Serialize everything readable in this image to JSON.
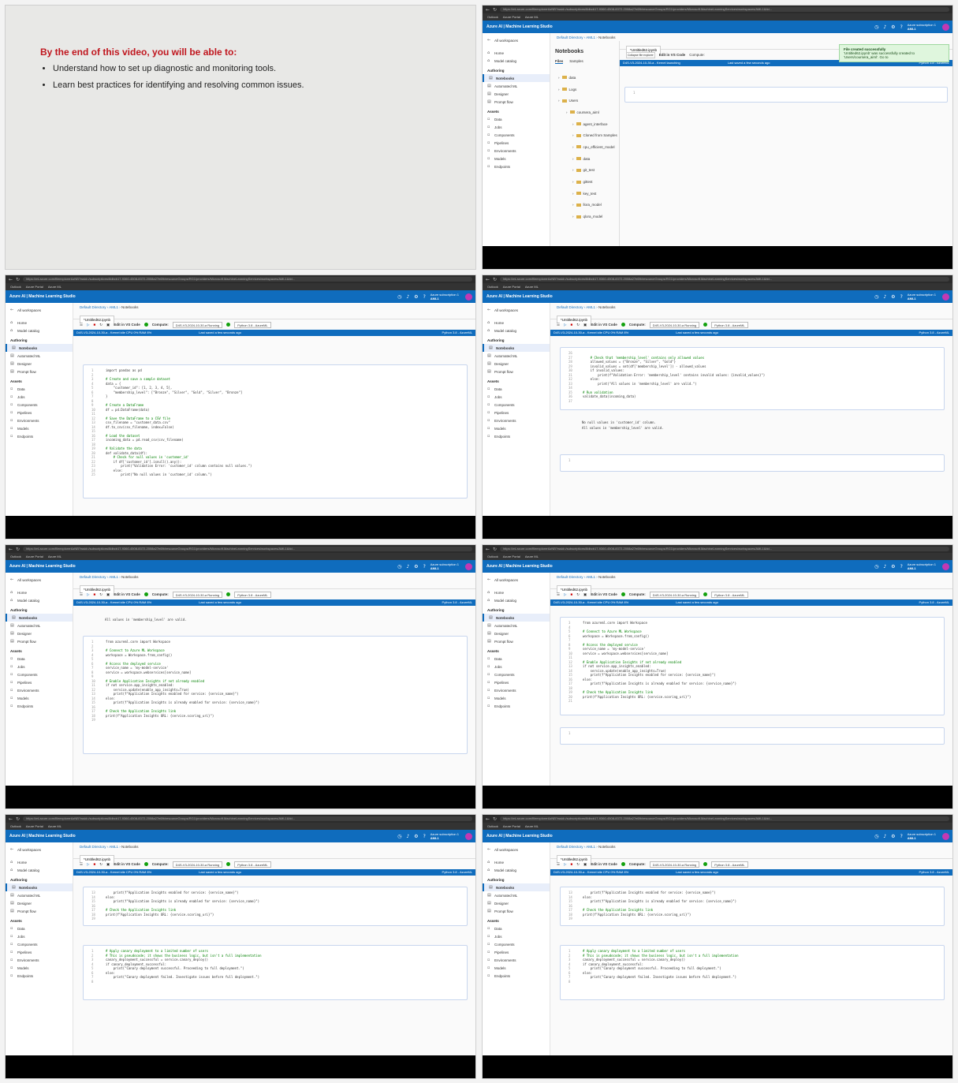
{
  "slide": {
    "heading": "By the end of this video, you will be able to:",
    "bullets": [
      "Understand how to set up diagnostic and monitoring tools.",
      "Learn best practices for identifying and resolving common issues."
    ]
  },
  "browser": {
    "url": "https://ml.azure.com/fileexplorerAzNB?wsid=/subscriptions/8dbcb17-9360-4508-8372-2008a27e6fb/resourceGroups/RG1/providers/Microsoft.MachineLearningServices/workspaces/AML1&tid...",
    "bookmarks": [
      "Outlook",
      "Azure Portal",
      "Azure ML"
    ]
  },
  "app": {
    "brand": "Azure AI | Machine Learning Studio",
    "subscription": "Azure subscription 1",
    "workspace": "AML1",
    "notification_count": "2"
  },
  "sidebar": {
    "all_workspaces": "All workspaces",
    "top_items": [
      "Home",
      "Model catalog"
    ],
    "authoring_label": "Authoring",
    "authoring_items": [
      "Notebooks",
      "Automated ML",
      "Designer",
      "Prompt flow"
    ],
    "assets_label": "Assets",
    "asset_items": [
      "Data",
      "Jobs",
      "Components",
      "Pipelines",
      "Environments",
      "Models",
      "Endpoints"
    ]
  },
  "breadcrumb": [
    "Default Directory",
    "AML1",
    "Notebooks"
  ],
  "notebook": {
    "file_tab": "*Untitled62.ipynb",
    "edit_vscode": "Edit in VS Code",
    "compute_label": "Compute:",
    "compute_name": "D4S-V3-2024-10-30-a",
    "compute_state": "Running",
    "kernel": "Python 3.8 - AzureML",
    "status_left": "D4S-V3-2024-10-30-a - Kernel idle  CPU  0%  RAM  8%",
    "status_mid": "Last saved a few seconds ago",
    "status_right": "Python 3.8 - AzureML",
    "files_label": "Files"
  },
  "explorer": {
    "title": "Notebooks",
    "tabs": [
      "Files",
      "Samples"
    ],
    "folders": [
      "data",
      "Logs",
      "Users",
      "coursera_aiml",
      "agent_interface",
      "Cloned from Samples",
      "cpu_efficient_model",
      "data",
      "git_test",
      "gittest",
      "key_test",
      "llora_model",
      "qlora_model"
    ],
    "tooltip": "Collapse file explorer",
    "status_left": "D4S-V3-2024-10-30-a - Kernel launching",
    "toast_title": "File created successfully",
    "toast_body": "'Untitled62.ipynb' was successfully created to 'Users/coursera_aiml'. Go to"
  },
  "cells": {
    "pandas": [
      "import pandas as pd",
      "",
      "# Create and save a sample dataset",
      "data = {",
      "    \"customer_id\": [1, 2, 3, 4, 5],",
      "    \"membership_level\": [\"Bronze\", \"Silver\", \"Gold\", \"Silver\", \"Bronze\"]",
      "}",
      "",
      "# Create a DataFrame",
      "df = pd.DataFrame(data)",
      "",
      "# Save the DataFrame to a CSV file",
      "csv_filename = \"customer_data.csv\"",
      "df.to_csv(csv_filename, index=False)",
      "",
      "# Load the dataset",
      "incoming_data = pd.read_csv(csv_filename)",
      "",
      "# Validate the data",
      "def validate_data(df):",
      "    # Check for null values in 'customer_id'",
      "    if df['customer_id'].isnull().any():",
      "        print(\"Validation Error: 'customer_id' column contains null values.\")",
      "    else:",
      "        print(\"No null values in 'customer_id' column.\")"
    ],
    "validation_tail": [
      "",
      "    # Check that 'membership_level' contains only allowed values",
      "    allowed_values = {\"Bronze\", \"Silver\", \"Gold\"}",
      "    invalid_values = set(df['membership_level']) - allowed_values",
      "    if invalid_values:",
      "        print(f\"Validation Error: 'membership_level' contains invalid values: {invalid_values}\")",
      "    else:",
      "        print(\"All values in 'membership_level' are valid.\")",
      "",
      "# Run validation",
      "validate_data(incoming_data)",
      ""
    ],
    "validation_output": [
      "No null values in 'customer_id' column.",
      "All values in 'membership_level' are valid."
    ],
    "insights": [
      "from azureml.core import Workspace",
      "",
      "# Connect to Azure ML Workspace",
      "workspace = Workspace.from_config()",
      "",
      "# Access the deployed service",
      "service_name = 'my-model-service'",
      "service = workspace.webservices[service_name]",
      "",
      "# Enable Application Insights if not already enabled",
      "if not service.app_insights_enabled:",
      "    service.update(enable_app_insights=True)",
      "    print(f\"Application Insights enabled for service: {service_name}\")",
      "else:",
      "    print(f\"Application Insights is already enabled for service: {service_name}\")",
      "",
      "# Check the Application Insights link",
      "print(f\"Application Insights URL: {service.scoring_uri}\")",
      ""
    ],
    "canary": [
      "# Apply canary deployment to a limited number of users",
      "# This is pseudocode; it shows the business logic, but isn't a full implementation",
      "canary_deployment_successful = service.canary_deploy()",
      "if canary_deployment_successful:",
      "    print(\"Canary deployment successful. Proceeding to full deployment.\")",
      "else:",
      "    print(\"Canary deployment failed. Investigate issues before full deployment.\")",
      ""
    ],
    "insights_tail": [
      "    print(f\"Application Insights enabled for service: {service_name}\")",
      "else:",
      "    print(f\"Application Insights is already enabled for service: {service_name}\")",
      "",
      "# Check the Application Insights link",
      "print(f\"Application Insights URL: {service.scoring_uri}\")",
      ""
    ],
    "valid_line": "All values in 'membership_level' are valid.",
    "empty_cell": "1"
  }
}
